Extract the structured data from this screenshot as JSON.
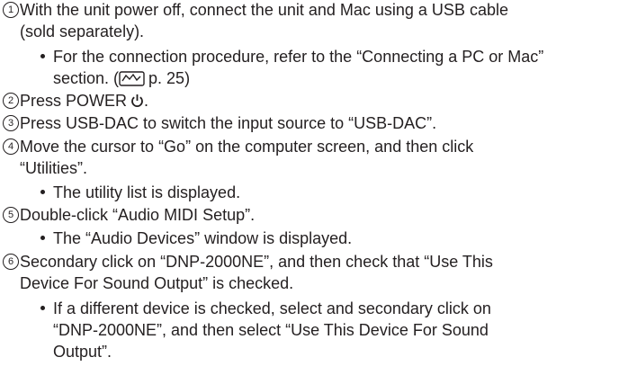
{
  "steps": [
    {
      "num": "1",
      "lines": [
        "With the unit power off, connect the unit and Mac using a USB cable",
        "(sold separately)."
      ]
    },
    {
      "num": "2",
      "text": "Press POWER"
    },
    {
      "num": "3",
      "text": "Press USB-DAC to switch the input source to “USB-DAC”."
    },
    {
      "num": "4",
      "lines": [
        "Move the cursor to “Go” on the computer screen, and then click",
        "“Utilities”."
      ]
    },
    {
      "num": "5",
      "text": "Double-click “Audio MIDI Setup”."
    },
    {
      "num": "6",
      "lines": [
        "Secondary click on “DNP-2000NE”, and then check that “Use This",
        "Device For Sound Output” is checked."
      ]
    }
  ],
  "bullets": {
    "b1": [
      "For the connection procedure, refer to the “Connecting a PC or Mac”",
      "section. (",
      "p. 25)"
    ],
    "b4": "The utility list is displayed.",
    "b5": "The “Audio Devices” window is displayed.",
    "b6": [
      "If a different device is checked, select and secondary click on",
      "“DNP-2000NE”, and then select “Use This Device For Sound",
      "Output”."
    ]
  },
  "icons": {
    "page_ref": "page-reference-icon",
    "power": "power-icon"
  }
}
